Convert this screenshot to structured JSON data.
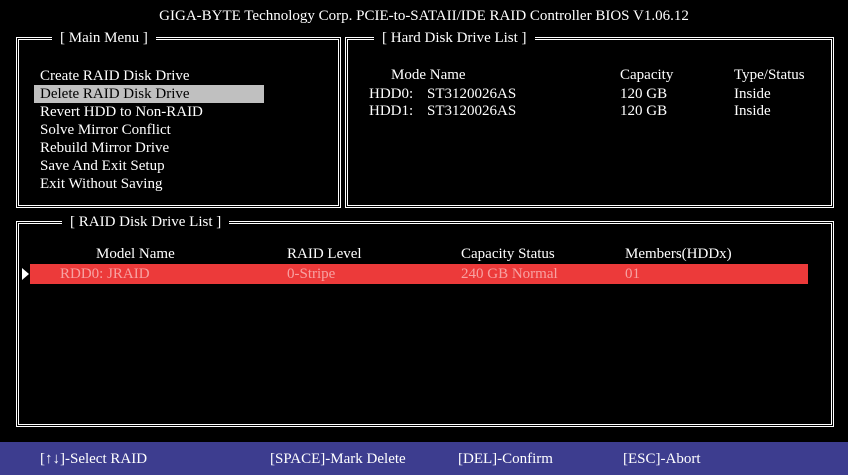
{
  "title": "GIGA-BYTE Technology Corp. PCIE-to-SATAII/IDE RAID Controller BIOS V1.06.12",
  "main_menu": {
    "caption": "[ Main Menu ]",
    "items": [
      "Create RAID Disk Drive",
      "Delete RAID Disk Drive",
      "Revert HDD to Non-RAID",
      "Solve Mirror Conflict",
      "Rebuild Mirror Drive",
      "Save And Exit Setup",
      "Exit Without Saving"
    ],
    "selected_index": 1
  },
  "hdd_list": {
    "caption": "[ Hard Disk Drive List ]",
    "headers": {
      "mode_name": "Mode Name",
      "capacity": "Capacity",
      "type_status": "Type/Status"
    },
    "rows": [
      {
        "id": "HDD0:",
        "model": "ST3120026AS",
        "capacity": "120 GB",
        "status": "Inside"
      },
      {
        "id": "HDD1:",
        "model": "ST3120026AS",
        "capacity": "120 GB",
        "status": "Inside"
      }
    ]
  },
  "raid_list": {
    "caption": "[ RAID Disk Drive List ]",
    "headers": {
      "model_name": "Model Name",
      "raid_level": "RAID Level",
      "capacity_status": "Capacity Status",
      "members": "Members(HDDx)"
    },
    "rows": [
      {
        "model": "RDD0: JRAID",
        "level": "0-Stripe",
        "capacity_status": "240 GB Normal",
        "members": "01"
      }
    ]
  },
  "help_bar": {
    "select": "[↑↓]-Select RAID",
    "mark": "[SPACE]-Mark Delete",
    "confirm": "[DEL]-Confirm",
    "abort": "[ESC]-Abort"
  },
  "colors": {
    "background": "#000000",
    "selection": "#c0c0c0",
    "raid_row_highlight": "#ec3a3a",
    "raid_row_text": "#f7a2a2",
    "help_bar": "#3d3d8f"
  },
  "icons": {
    "row_pointer": "triangle-right-icon"
  }
}
